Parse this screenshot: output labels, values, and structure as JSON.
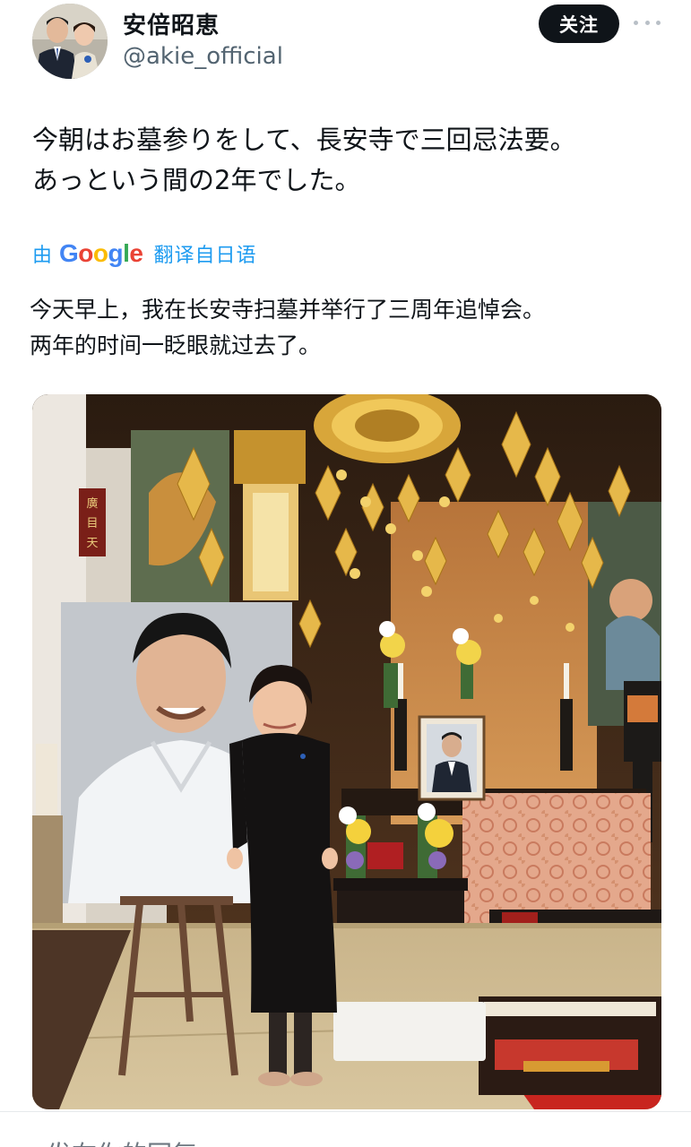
{
  "post": {
    "display_name": "安倍昭恵",
    "handle": "@akie_official",
    "follow_label": "关注",
    "original_lines": [
      "今朝はお墓参りをして、長安寺で三回忌法要。",
      "あっという間の2年でした。"
    ],
    "translation": {
      "by_label": "由",
      "provider": "Google",
      "from_label": "翻译自日语"
    },
    "translated_lines": [
      "今天早上，我在长安寺扫墓并举行了三周年追悼会。",
      "两年的时间一眨眼就过去了。"
    ],
    "photo": {
      "plaque_text": "廣目天",
      "icons": {
        "more": "more-horizontal-icon"
      }
    }
  },
  "reply": {
    "placeholder": "发布你的回复"
  },
  "colors": {
    "accent": "#1d9bf0",
    "follow_bg": "#0f1419",
    "muted_text": "#536471"
  }
}
